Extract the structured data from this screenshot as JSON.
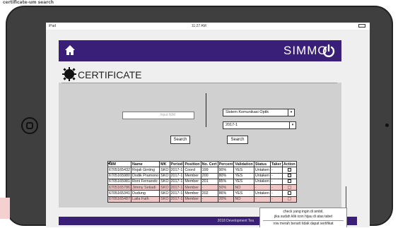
{
  "caption": "certificate-um search",
  "statusbar": {
    "carrier": "iPad",
    "time": "11:27 AM"
  },
  "header": {
    "brand": "SIMMO"
  },
  "page": {
    "title": "CERTIFICATE"
  },
  "search_left": {
    "placeholder": "Input NIM",
    "button": "Search"
  },
  "search_right": {
    "program": "Sistem Komunikasi Optik",
    "period": "2017-1",
    "button": "Search"
  },
  "table": {
    "headers": [
      "NIM",
      "Name",
      "MK",
      "Period",
      "Position",
      "No. Cert",
      "Percent",
      "Validation",
      "Status",
      "Taker",
      "Action"
    ],
    "rows": [
      {
        "nim": "6705165432",
        "name": "Rojali Ginting",
        "mk": "SKO",
        "period": "2017-1",
        "position": "Coord",
        "no_cert": "199",
        "percent": "90%",
        "validation": "YES",
        "status": "Untaken",
        "taker": "-",
        "action": "checked",
        "flagged": false
      },
      {
        "nim": "6705165980",
        "name": "Dodik Pramono",
        "mk": "SKO",
        "period": "2017-1",
        "position": "Member",
        "no_cert": "200",
        "percent": "80%",
        "validation": "YES",
        "status": "Untaken",
        "taker": "-",
        "action": "checked",
        "flagged": false
      },
      {
        "nim": "6705165981",
        "name": "Roni Fernando",
        "mk": "SKO",
        "period": "2017-1",
        "position": "Member",
        "no_cert": "201",
        "percent": "85%",
        "validation": "YES",
        "status": "Untaken",
        "taker": "-",
        "action": "unchecked",
        "flagged": false
      },
      {
        "nim": "6705165786",
        "name": "Jimmy Setiadi",
        "mk": "SKO",
        "period": "2017-1",
        "position": "Member",
        "no_cert": "-",
        "percent": "50%",
        "validation": "NO",
        "status": "-",
        "taker": "-",
        "action": "disabled",
        "flagged": true
      },
      {
        "nim": "6705165341",
        "name": "Dudung",
        "mk": "SKO",
        "period": "2017-1",
        "position": "Member",
        "no_cert": "202",
        "percent": "86%",
        "validation": "YES",
        "status": "Untaken",
        "taker": "-",
        "action": "unchecked",
        "flagged": false
      },
      {
        "nim": "6705165487",
        "name": "Laila Fath",
        "mk": "SKO",
        "period": "2017-1",
        "position": "Member",
        "no_cert": "-",
        "percent": "20%",
        "validation": "NO",
        "status": "-",
        "taker": "-",
        "action": "disabled",
        "flagged": true
      }
    ]
  },
  "callout": {
    "line1": "check yang ingin di ambil,",
    "line2": "jika sudah klik icon hijau di atas tabel",
    "line3": "row merah berarti tidak dapat sertifikat"
  },
  "footer": {
    "text": "2018 Development Tea"
  },
  "colors": {
    "brand_purple": "#3a1f78",
    "flag_row": "#f3c6c6",
    "confirm_green": "#2fae3a"
  },
  "icons": {
    "home": "home-icon",
    "power": "power-icon",
    "section": "gear-badge-icon",
    "confirm": "green-check-circle-icon"
  }
}
